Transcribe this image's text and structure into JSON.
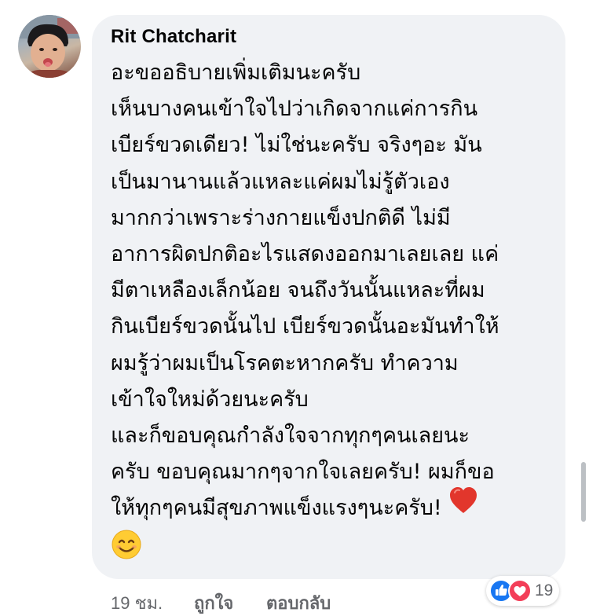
{
  "comment": {
    "author": "Rit Chatcharit",
    "lines": [
      "อะขออธิบายเพิ่มเติมนะครับ",
      "เห็นบางคนเข้าใจไปว่าเกิดจากแค่การกิน",
      "เบียร์ขวดเดียว! ไม่ใช่นะครับ จริงๆอะ มัน",
      "เป็นมานานแล้วแหละแค่ผมไม่รู้ตัวเอง",
      "มากกว่าเพราะร่างกายแข็งปกติดี ไม่มี",
      "อาการผิดปกติอะไรแสดงออกมาเลยเลย แค่",
      "มีตาเหลืองเล็กน้อย จนถึงวันนั้นแหละที่ผม",
      "กินเบียร์ขวดนั้นไป เบียร์ขวดนั้นอะมันทำให้",
      "ผมรู้ว่าผมเป็นโรคตะหากครับ ทำความ",
      "เข้าใจใหม่ด้วยนะครับ",
      "และก็ขอบคุณกำลังใจจากทุกๆคนเลยนะ",
      "ครับ ขอบคุณมากๆจากใจเลยครับ! ผมก็ขอ",
      "ให้ทุกๆคนมีสุขภาพแข็งแรงๆนะครับ!"
    ],
    "emoji_heart": "red-heart-emoji",
    "emoji_smile": "smiling-face-emoji"
  },
  "meta": {
    "time": "19 ชม.",
    "like_label": "ถูกใจ",
    "reply_label": "ตอบกลับ"
  },
  "reactions": {
    "count": "19",
    "types": [
      "like-reaction-icon",
      "love-reaction-icon"
    ]
  },
  "colors": {
    "bubble_bg": "#f0f2f5",
    "text": "#050505",
    "meta_text": "#65676b",
    "like_blue": "#1877f2",
    "love_red": "#f33e58"
  }
}
